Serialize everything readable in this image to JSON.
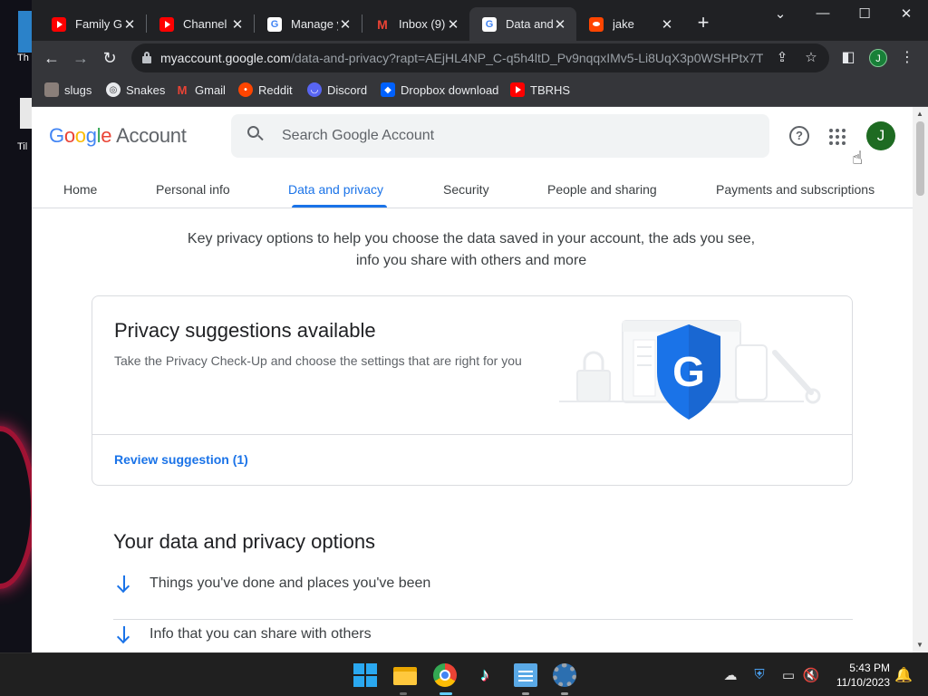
{
  "desktop": {
    "label_1": "Th",
    "label_2": "Til"
  },
  "browser": {
    "tabs": [
      {
        "title": "Family Gu",
        "favicon": "youtube-icon"
      },
      {
        "title": "Channel c",
        "favicon": "youtube-icon"
      },
      {
        "title": "Manage y",
        "favicon": "google-icon"
      },
      {
        "title": "Inbox (9)",
        "favicon": "gmail-icon"
      },
      {
        "title": "Data and",
        "favicon": "google-icon",
        "active": true
      },
      {
        "title": "jake",
        "favicon": "reddit-icon"
      }
    ],
    "url_host": "myaccount.google.com",
    "url_path": "/data-and-privacy?rapt=AEjHL4NP_C-q5h4ltD_Pv9nqqxIMv5-Li8UqX3p0WSHPtx7T...",
    "profile_initial": "J",
    "bookmarks": [
      "slugs",
      "Snakes",
      "Gmail",
      "Reddit",
      "Discord",
      "Dropbox download",
      "TBRHS"
    ]
  },
  "account": {
    "logo_google": "Google",
    "logo_account": "Account",
    "search_placeholder": "Search Google Account",
    "avatar_initial": "J",
    "nav_tabs": [
      "Home",
      "Personal info",
      "Data and privacy",
      "Security",
      "People and sharing",
      "Payments and subscriptions"
    ],
    "active_tab": "Data and privacy",
    "intro": "Key privacy options to help you choose the data saved in your account, the ads you see, info you share with others and more",
    "card": {
      "title": "Privacy suggestions available",
      "description": "Take the Privacy Check-Up and choose the settings that are right for you",
      "link": "Review suggestion (1)"
    },
    "options_title": "Your data and privacy options",
    "options": [
      "Things you've done and places you've been",
      "Info that you can share with others"
    ]
  },
  "taskbar": {
    "time": "5:43 PM",
    "date": "11/10/2023"
  },
  "colors": {
    "accent": "#1a73e8",
    "avatar": "#1e6b22",
    "chrome_dark": "#202124"
  }
}
